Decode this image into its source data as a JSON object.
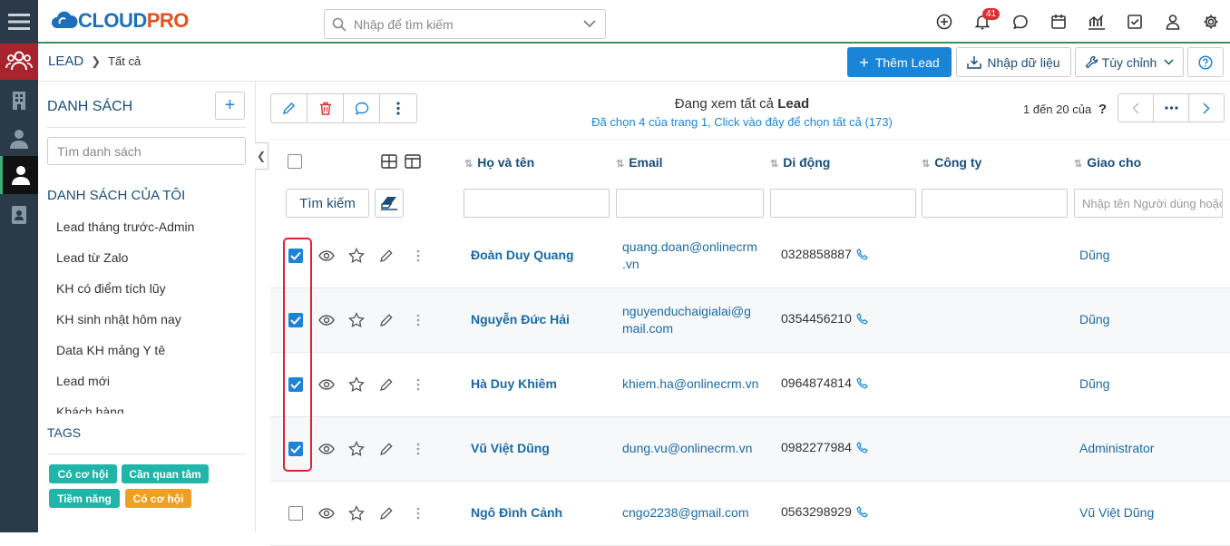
{
  "app": {
    "logo_main": "CLOUDPRO",
    "notifications_count": "41"
  },
  "search": {
    "placeholder": "Nhập để tìm kiếm"
  },
  "breadcrumb": {
    "module": "LEAD",
    "current": "Tất cả"
  },
  "actions": {
    "add_label": "Thêm Lead",
    "import_label": "Nhập dữ liệu",
    "customize_label": "Tùy chỉnh"
  },
  "sidebar": {
    "title": "DANH SÁCH",
    "search_placeholder": "Tìm danh sách",
    "my_lists_title": "DANH SÁCH CỦA TÔI",
    "lists": [
      "Lead tháng trước-Admin",
      "Lead từ Zalo",
      "KH có điểm tích lũy",
      "KH sinh nhật hôm nay",
      "Data KH mảng Y tê",
      "Lead mới",
      "Khách hàng"
    ],
    "tags_title": "TAGS",
    "tags": [
      {
        "label": "Có cơ hội",
        "color": "#1fb5a8"
      },
      {
        "label": "Cần quan tâm",
        "color": "#1fb5a8"
      },
      {
        "label": "Tiềm năng",
        "color": "#1fb5a8"
      },
      {
        "label": "Có cơ hội",
        "color": "#f0a020"
      }
    ]
  },
  "listview": {
    "viewing_prefix": "Đang xem tất cả",
    "viewing_module": "Lead",
    "selection_info": "Đã chọn 4 của trang 1, Click vào đây để chọn tất cả (173)",
    "page_info": "1 đến 20 của",
    "page_help": "?",
    "columns": {
      "name": "Họ và tên",
      "email": "Email",
      "mobile": "Di động",
      "company": "Công ty",
      "assigned": "Giao cho"
    },
    "filter": {
      "search_button": "Tìm kiếm",
      "assigned_placeholder": "Nhập tên Người dùng hoặc nhóm"
    },
    "rows": [
      {
        "checked": true,
        "name": "Đoàn Duy Quang",
        "email_l1": "quang.doan@onlinecrm",
        "email_l2": ".vn",
        "mobile": "0328858887",
        "assigned": "Dũng"
      },
      {
        "checked": true,
        "name": "Nguyễn Đức Hải",
        "email_l1": "nguyenduchaigialai@g",
        "email_l2": "mail.com",
        "mobile": "0354456210",
        "assigned": "Dũng"
      },
      {
        "checked": true,
        "name": "Hà Duy Khiêm",
        "email_l1": "khiem.ha@onlinecrm.vn",
        "email_l2": "",
        "mobile": "0964874814",
        "assigned": "Dũng"
      },
      {
        "checked": true,
        "name": "Vũ Việt Dũng",
        "email_l1": "dung.vu@onlinecrm.vn",
        "email_l2": "",
        "mobile": "0982277984",
        "assigned": "Administrator"
      },
      {
        "checked": false,
        "name": "Ngô Đình Cảnh",
        "email_l1": "cngo2238@gmail.com",
        "email_l2": "",
        "mobile": "0563298929",
        "assigned": "Vũ Việt Dũng"
      }
    ]
  }
}
